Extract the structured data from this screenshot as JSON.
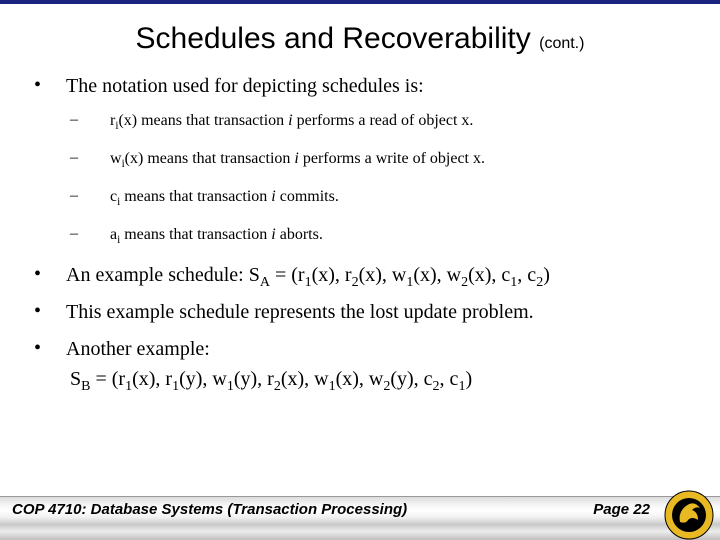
{
  "title": {
    "main": "Schedules and Recoverability",
    "cont": "(cont.)"
  },
  "items": {
    "intro": "The notation used for depicting schedules is:",
    "sub1_pre": "r",
    "sub1_post": "(x)  means that transaction ",
    "sub1_tail": " performs a read of object x.",
    "sub2_pre": "w",
    "sub2_post": "(x) means that transaction ",
    "sub2_tail": " performs a write of object x.",
    "sub3_pre": "c",
    "sub3_post": " means that transaction ",
    "sub3_tail": " commits.",
    "sub4_pre": "a",
    "sub4_post": " means that transaction ",
    "sub4_tail": " aborts.",
    "ex_lead": "An example schedule: S",
    "ex_sub": "A",
    "ex_body": " = (r",
    "ex_r1": "1",
    "ex_b2": "(x), r",
    "ex_r2": "2",
    "ex_b3": "(x), w",
    "ex_w1": "1",
    "ex_b4": "(x), w",
    "ex_w2": "2",
    "ex_b5": "(x), c",
    "ex_c1": "1",
    "ex_b6": ", c",
    "ex_c2": "2",
    "ex_tail": ")",
    "lost": "This example schedule represents the lost update problem.",
    "another": "Another example:",
    "sb_lead": "S",
    "sb_sub": "B",
    "sb_b1": " = (r",
    "sb_s1": "1",
    "sb_b2": "(x), r",
    "sb_s2": "1",
    "sb_b3": "(y), w",
    "sb_s3": "1",
    "sb_b4": "(y), r",
    "sb_s4": "2",
    "sb_b5": "(x), w",
    "sb_s5": "1",
    "sb_b6": "(x), w",
    "sb_s6": "2",
    "sb_b7": "(y), c",
    "sb_s7": "2",
    "sb_b8": ", c",
    "sb_s8": "1",
    "sb_tail": ")",
    "i_var": "i"
  },
  "footer": {
    "course": "COP 4710: Database Systems  (Transaction Processing)",
    "page": "Page 22"
  }
}
